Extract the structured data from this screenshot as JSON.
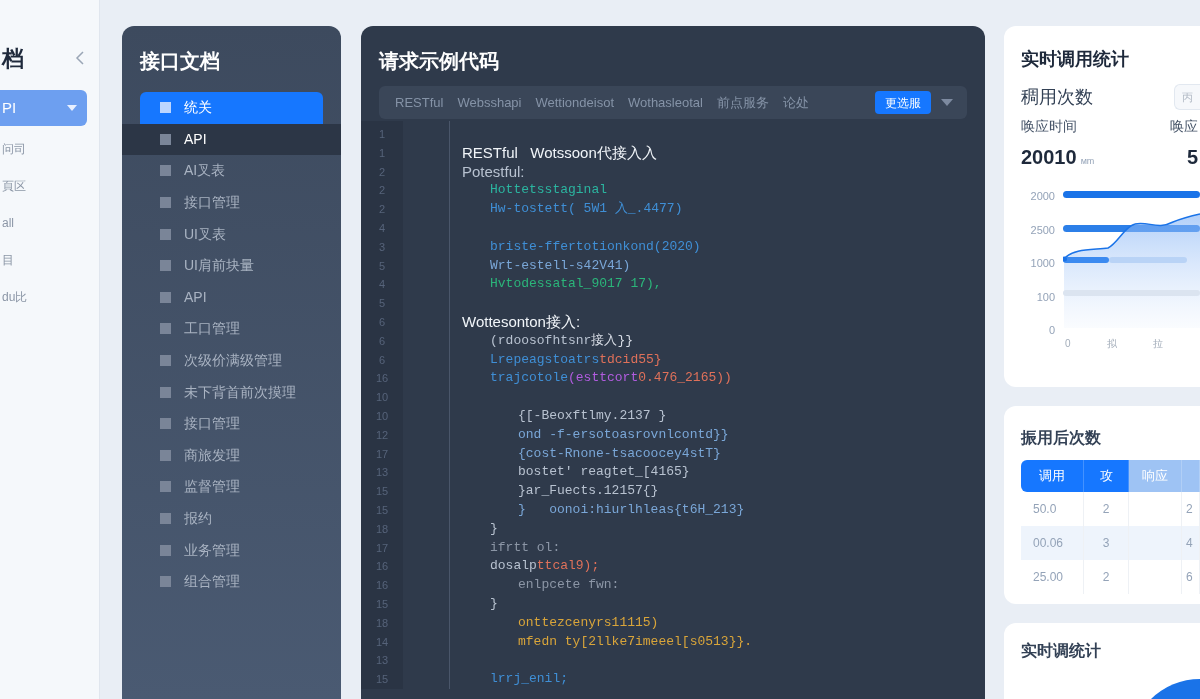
{
  "nav": {
    "title": "档",
    "items": [
      {
        "label": "PI",
        "selected": true
      },
      {
        "label": "问司",
        "selected": false
      },
      {
        "label": "頁区",
        "selected": false
      },
      {
        "label": "all",
        "selected": false
      },
      {
        "label": "目",
        "selected": false
      },
      {
        "label": "du比",
        "selected": false
      }
    ]
  },
  "sidebar": {
    "title": "接口文档",
    "items": [
      {
        "label": "统关",
        "selected": true,
        "highlighted": false
      },
      {
        "label": "API",
        "selected": false,
        "highlighted": true
      },
      {
        "label": "AI叉表",
        "selected": false,
        "highlighted": false
      },
      {
        "label": "接口管理",
        "selected": false,
        "highlighted": false
      },
      {
        "label": "UI叉表",
        "selected": false,
        "highlighted": false
      },
      {
        "label": "UI肩前块量",
        "selected": false,
        "highlighted": false
      },
      {
        "label": "API",
        "selected": false,
        "highlighted": false
      },
      {
        "label": "工口管理",
        "selected": false,
        "highlighted": false
      },
      {
        "label": "次级价满级管理",
        "selected": false,
        "highlighted": false
      },
      {
        "label": "未下背首前次摸理",
        "selected": false,
        "highlighted": false
      },
      {
        "label": "接口管理",
        "selected": false,
        "highlighted": false
      },
      {
        "label": "商旅发理",
        "selected": false,
        "highlighted": false
      },
      {
        "label": "监督管理",
        "selected": false,
        "highlighted": false
      },
      {
        "label": "报约",
        "selected": false,
        "highlighted": false
      },
      {
        "label": "业务管理",
        "selected": false,
        "highlighted": false
      },
      {
        "label": "组合管理",
        "selected": false,
        "highlighted": false
      }
    ]
  },
  "code_panel": {
    "title": "请求示例代码",
    "tabs": [
      {
        "label": "RESTful",
        "selected": false
      },
      {
        "label": "Websshapi",
        "selected": false
      },
      {
        "label": "Wettiondeisot",
        "selected": false
      },
      {
        "label": "Wothasleotal",
        "selected": false
      },
      {
        "label": "前点服务",
        "selected": false
      },
      {
        "label": "论处",
        "selected": false
      },
      {
        "label": "更选服",
        "selected": true
      }
    ],
    "lines": [
      {
        "number": "1",
        "kind": "blank"
      },
      {
        "number": "1",
        "kind": "heading",
        "parts": [
          {
            "text": "RESTful   Wotssoon代接入入",
            "color": "#f1f5f9"
          }
        ]
      },
      {
        "number": "2",
        "kind": "heading",
        "parts": [
          {
            "text": "Potestful:",
            "color": "#b8c2d0"
          }
        ]
      },
      {
        "number": "2",
        "kind": "body",
        "parts": [
          {
            "text": "Hottetsstaginal",
            "color": "#2bb5a0"
          }
        ]
      },
      {
        "number": "2",
        "kind": "body",
        "parts": [
          {
            "text": "Hw-tostett( 5W1 入_.4477)",
            "color": "#3f8fd6"
          }
        ]
      },
      {
        "number": "4",
        "kind": "blank"
      },
      {
        "number": "3",
        "kind": "body",
        "parts": [
          {
            "text": "briste-ffertotionkond(2020)",
            "color": "#3f8fd6"
          }
        ]
      },
      {
        "number": "5",
        "kind": "body",
        "parts": [
          {
            "text": "Wrt-estell-s42V41)",
            "color": "#7aa7d8"
          }
        ]
      },
      {
        "number": "4",
        "kind": "body",
        "parts": [
          {
            "text": "Hvtodessatal_9017 17),",
            "color": "#2bb57a"
          }
        ]
      },
      {
        "number": "5",
        "kind": "blank"
      },
      {
        "number": "6",
        "kind": "heading",
        "parts": [
          {
            "text": "Wottesonton接入:",
            "color": "#f1f5f9"
          }
        ]
      },
      {
        "number": "6",
        "kind": "body",
        "parts": [
          {
            "text": "(rdoosofhtsnr",
            "color": "#b8c2d0"
          },
          {
            "text": "接入}}",
            "color": "#d8dde6"
          }
        ]
      },
      {
        "number": "6",
        "kind": "body",
        "parts": [
          {
            "text": "Lrepeagstoatrs",
            "color": "#3f8fd6"
          },
          {
            "text": "tdcid55}",
            "color": "#e0715a"
          }
        ]
      },
      {
        "number": "16",
        "kind": "body",
        "parts": [
          {
            "text": "trajcotole",
            "color": "#3f8fd6"
          },
          {
            "text": "(esttcort",
            "color": "#b25ce0"
          },
          {
            "text": "0.476_2165))",
            "color": "#e0715a"
          }
        ]
      },
      {
        "number": "10",
        "kind": "blank"
      },
      {
        "number": "10",
        "kind": "nested",
        "parts": [
          {
            "text": "{[-Beoxftlmy.2137 }",
            "color": "#b8c2d0"
          }
        ]
      },
      {
        "number": "12",
        "kind": "nested",
        "parts": [
          {
            "text": "ond -f-ersotoasrovnlcontd}}",
            "color": "#7aa7d8"
          }
        ]
      },
      {
        "number": "17",
        "kind": "nested",
        "parts": [
          {
            "text": "{cost-Rnone-tsacoocey4stT}",
            "color": "#7aa7d8"
          }
        ]
      },
      {
        "number": "13",
        "kind": "nested",
        "parts": [
          {
            "text": "bostet' reagtet_[4165}",
            "color": "#b8c2d0"
          }
        ]
      },
      {
        "number": "15",
        "kind": "nested",
        "parts": [
          {
            "text": "}ar_Fuects.12157{}",
            "color": "#b8c2d0"
          }
        ]
      },
      {
        "number": "15",
        "kind": "nested",
        "parts": [
          {
            "text": "}   oonoi:hiurlhleas{t6H_213}",
            "color": "#7aa7d8"
          }
        ]
      },
      {
        "number": "18",
        "kind": "body",
        "parts": [
          {
            "text": "}",
            "color": "#b8c2d0"
          }
        ]
      },
      {
        "number": "17",
        "kind": "body",
        "parts": [
          {
            "text": "ifrtt ol:",
            "color": "#8c96a6"
          }
        ]
      },
      {
        "number": "16",
        "kind": "body",
        "parts": [
          {
            "text": "dosalp",
            "color": "#b8c2d0"
          },
          {
            "text": "ttcal9);",
            "color": "#e0715a"
          }
        ]
      },
      {
        "number": "16",
        "kind": "nested",
        "parts": [
          {
            "text": "enlpcete fwn:",
            "color": "#8c96a6"
          }
        ]
      },
      {
        "number": "15",
        "kind": "body",
        "parts": [
          {
            "text": "}",
            "color": "#b8c2d0"
          }
        ]
      },
      {
        "number": "18",
        "kind": "nested",
        "parts": [
          {
            "text": "onttezcenyrs11115)",
            "color": "#d9a53a"
          }
        ]
      },
      {
        "number": "14",
        "kind": "nested",
        "parts": [
          {
            "text": "mfedn ty[2llke7imeeel[s0513}}.",
            "color": "#d9a53a"
          }
        ]
      },
      {
        "number": "13",
        "kind": "blank"
      },
      {
        "number": "15",
        "kind": "body",
        "parts": [
          {
            "text": "lrrj_enil;",
            "color": "#3f8fd6"
          }
        ]
      }
    ]
  },
  "stats": {
    "title": "实时调用统计",
    "label": "稠用次数",
    "button": "丙",
    "metrics": [
      {
        "label": "唤应时间",
        "value": "20010",
        "unit": "мm"
      },
      {
        "label": "唤应",
        "value": "5"
      }
    ],
    "y_labels": [
      "2000",
      "2500",
      "1000",
      "100",
      "0"
    ],
    "x_labels": [
      "0",
      "拟",
      "拉"
    ]
  },
  "table": {
    "title": "振用后次数",
    "columns": [
      {
        "label": "调用",
        "selected": true
      },
      {
        "label": "攻",
        "selected": true
      },
      {
        "label": "响应",
        "selected": false
      },
      {
        "selected": false
      }
    ],
    "rows": [
      [
        "50.0",
        "2",
        "",
        "2"
      ],
      [
        "00.06",
        "3",
        "",
        "4"
      ],
      [
        "25.00",
        "2",
        "",
        "6"
      ]
    ]
  },
  "summary": {
    "title": "实时调统计"
  }
}
